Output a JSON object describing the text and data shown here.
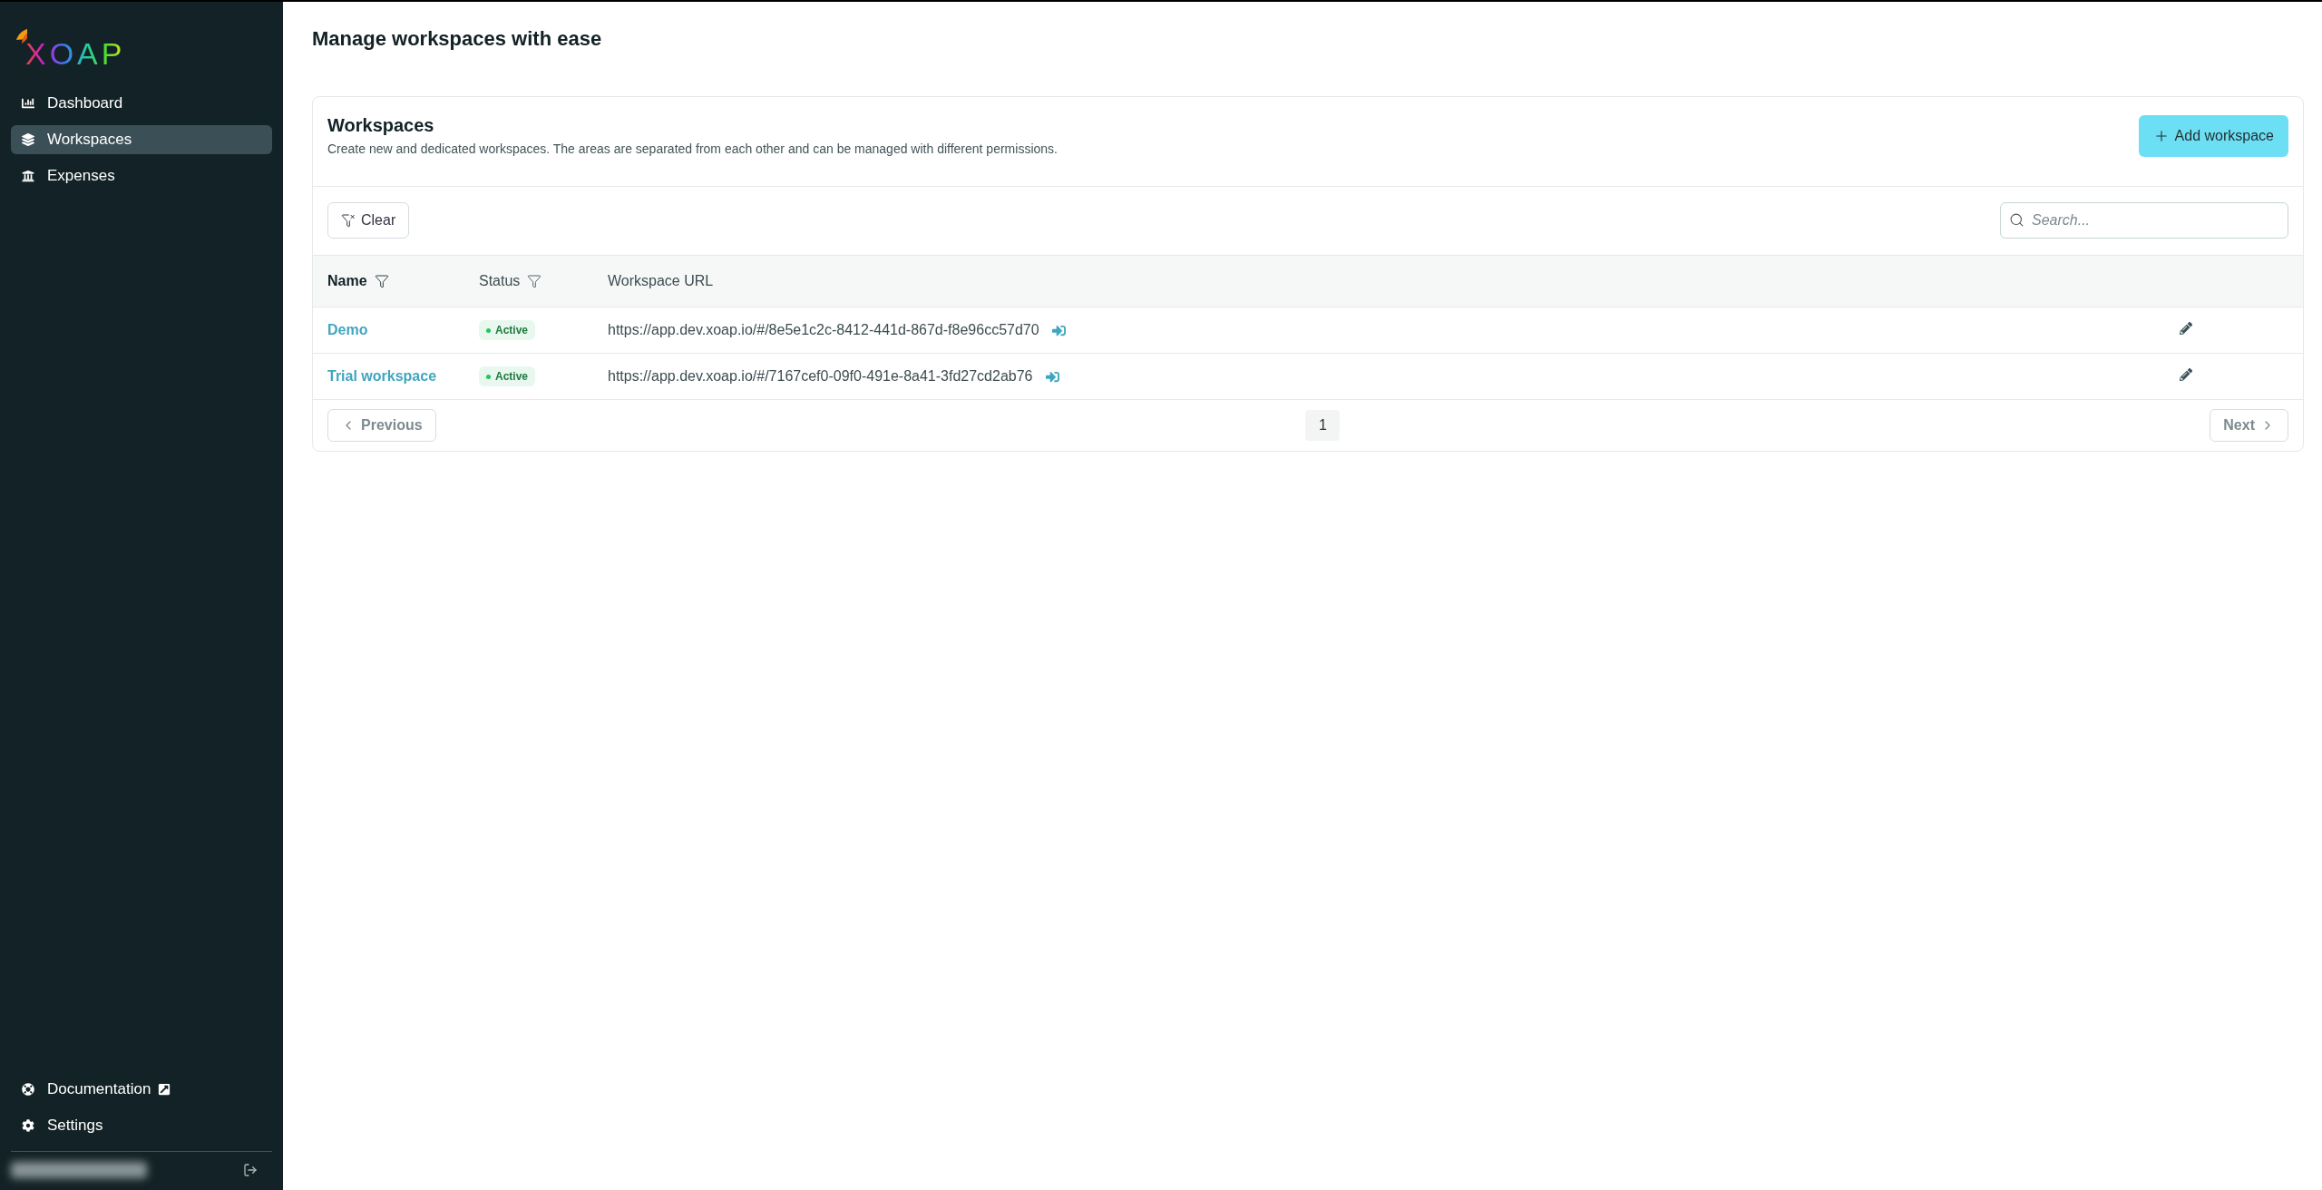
{
  "sidebar": {
    "logo": "XOAP",
    "items": [
      {
        "label": "Dashboard",
        "selected": false
      },
      {
        "label": "Workspaces",
        "selected": true
      },
      {
        "label": "Expenses",
        "selected": false
      }
    ],
    "bottom_items": [
      {
        "label": "Documentation",
        "external": true
      },
      {
        "label": "Settings",
        "external": false
      }
    ]
  },
  "page": {
    "title": "Manage workspaces with ease"
  },
  "card": {
    "title": "Workspaces",
    "description": "Create new and dedicated workspaces. The areas are separated from each other and can be managed with different permissions.",
    "add_button": "Add workspace"
  },
  "toolbar": {
    "clear_button": "Clear",
    "search": {
      "placeholder": "Search..."
    }
  },
  "table": {
    "columns": [
      {
        "label": "Name",
        "filter": true
      },
      {
        "label": "Status",
        "filter": true
      },
      {
        "label": "Workspace URL",
        "filter": false
      }
    ],
    "rows": [
      {
        "name": "Demo",
        "status": "Active",
        "color": "#22c55e",
        "url": "https://app.dev.xoap.io/#/8e5e1c2c-8412-441d-867d-f8e96cc57d70"
      },
      {
        "name": "Trial workspace",
        "status": "Active",
        "color": "#22c55e",
        "url": "https://app.dev.xoap.io/#/7167cef0-09f0-491e-8a41-3fd27cd2ab76"
      }
    ]
  },
  "pagination": {
    "previous": {
      "label": "Previous",
      "disabled": true
    },
    "pages": [
      {
        "label": "1",
        "selected": true
      }
    ],
    "next": {
      "label": "Next",
      "disabled": true
    }
  }
}
